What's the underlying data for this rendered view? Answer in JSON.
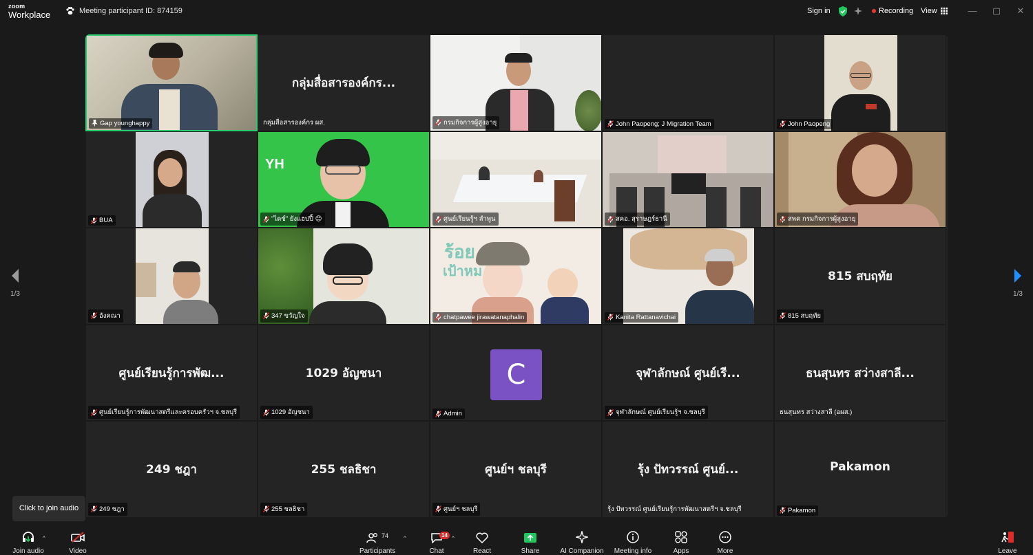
{
  "app": {
    "logo_top": "zoom",
    "logo_bottom": "Workplace",
    "meeting_id": "Meeting participant ID: 874159"
  },
  "topbar": {
    "signin": "Sign in",
    "recording": "Recording",
    "view": "View",
    "minimize": "—",
    "maximize": "▢",
    "close": "✕"
  },
  "pager": {
    "left": "1/3",
    "right": "1/3"
  },
  "tiles": [
    {
      "label": "Gap younghappy",
      "big": "",
      "muted": false,
      "active": true
    },
    {
      "label": "กลุ่มสื่อสารองค์กร ผส.",
      "big": "กลุ่มสื่อสารองค์กร...",
      "muted": false
    },
    {
      "label": "กรมกิจการผู้สูงอายุ",
      "big": "",
      "muted": true
    },
    {
      "label": "John Paopeng; J Migration Team",
      "big": "",
      "muted": true
    },
    {
      "label": "John Paopeng",
      "big": "",
      "muted": true
    },
    {
      "label": "BUA",
      "big": "",
      "muted": true
    },
    {
      "label": "\"ไดซ์\" ยังแฮปปี้ 😊",
      "big": "",
      "muted": true
    },
    {
      "label": "ศูนย์เรียนรู้ฯ ลำพูน",
      "big": "",
      "muted": true
    },
    {
      "label": "สคอ. สุราษฎร์ธานี",
      "big": "",
      "muted": true
    },
    {
      "label": "สพค กรมกิจการผู้สูงอายุ",
      "big": "",
      "muted": true
    },
    {
      "label": "อังคณา",
      "big": "",
      "muted": true
    },
    {
      "label": "347 ขวัญใจ",
      "big": "",
      "muted": true
    },
    {
      "label": "chatpawee jirawatanaphalin",
      "big": "",
      "muted": true
    },
    {
      "label": "Kanita Rattanavichai",
      "big": "",
      "muted": true
    },
    {
      "label": "815 สบฤทัย",
      "big": "815 สบฤทัย",
      "muted": true
    },
    {
      "label": "ศูนย์เรียนรู้การพัฒนาสตรีและครอบครัวฯ จ.ชลบุรี",
      "big": "ศูนย์เรียนรู้การพัฒ...",
      "muted": true
    },
    {
      "label": "1029 อัญชนา",
      "big": "1029 อัญชนา",
      "muted": true
    },
    {
      "label": "Admin",
      "big": "",
      "muted": true,
      "avatar": "C"
    },
    {
      "label": "จุฬาลักษณ์ ศูนย์เรียนรู้ฯ จ.ชลบุรี",
      "big": "จุฬาลักษณ์ ศูนย์เรี...",
      "muted": true
    },
    {
      "label": "ธนสุนทร สว่างสาลี (อผส.)",
      "big": "ธนสุนทร สว่างสาลี...",
      "muted": false
    },
    {
      "label": "249 ชฎา",
      "big": "249 ชฎา",
      "muted": true
    },
    {
      "label": "255 ชลธิชา",
      "big": "255 ชลธิชา",
      "muted": true
    },
    {
      "label": "ศูนย์ฯ ชลบุรี",
      "big": "ศูนย์ฯ ชลบุรี",
      "muted": true
    },
    {
      "label": "รุ้ง ปัทวรรณ์ ศูนย์เรียนรู้การพัฒนาสตรีฯ จ.ชลบุรี",
      "big": "รุ้ง ปัทวรรณ์ ศูนย์...",
      "muted": false
    },
    {
      "label": "Pakamon",
      "big": "Pakamon",
      "muted": true
    }
  ],
  "tooltip": "Click to join audio",
  "toolbar": {
    "join_audio": "Join audio",
    "video": "Video",
    "participants": "Participants",
    "participants_count": "74",
    "chat": "Chat",
    "chat_badge": "14",
    "react": "React",
    "share": "Share",
    "ai_companion": "AI Companion",
    "meeting_info": "Meeting info",
    "apps": "Apps",
    "more": "More",
    "leave": "Leave"
  },
  "colors": {
    "accent_green": "#2ecc71",
    "share_green": "#22c55e",
    "record_red": "#e53935",
    "avatar_purple": "#7b52c4",
    "pager_blue": "#1e90ff"
  }
}
